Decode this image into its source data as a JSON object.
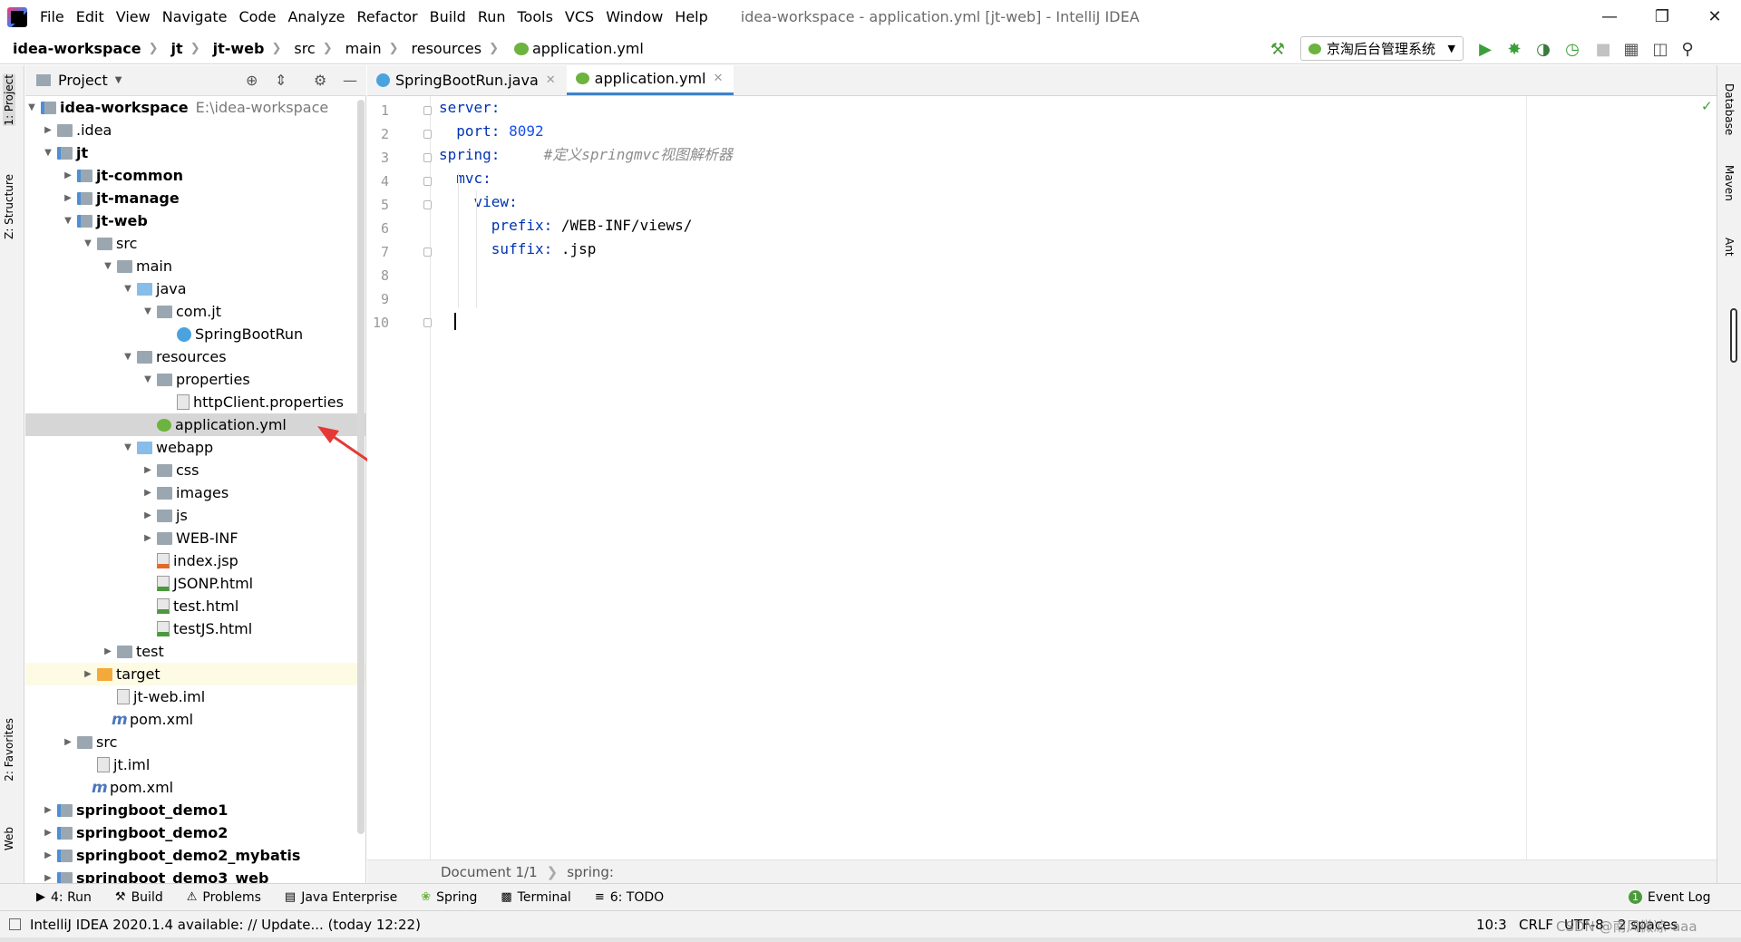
{
  "menubar": {
    "items": [
      "File",
      "Edit",
      "View",
      "Navigate",
      "Code",
      "Analyze",
      "Refactor",
      "Build",
      "Run",
      "Tools",
      "VCS",
      "Window",
      "Help"
    ],
    "window_title": "idea-workspace - application.yml [jt-web] - IntelliJ IDEA"
  },
  "breadcrumb": [
    "idea-workspace",
    "jt",
    "jt-web",
    "src",
    "main",
    "resources",
    "application.yml"
  ],
  "run_config": "京淘后台管理系统",
  "project_panel": {
    "title": "Project"
  },
  "left_strip": {
    "project": "1: Project",
    "structure": "Z: Structure",
    "favorites": "2: Favorites",
    "web": "Web"
  },
  "right_strip": {
    "database": "Database",
    "maven": "Maven",
    "ant": "Ant"
  },
  "tree": [
    {
      "label": "idea-workspace",
      "extra": "E:\\idea-workspace"
    },
    {
      "label": ".idea"
    },
    {
      "label": "jt"
    },
    {
      "label": "jt-common"
    },
    {
      "label": "jt-manage"
    },
    {
      "label": "jt-web"
    },
    {
      "label": "src"
    },
    {
      "label": "main"
    },
    {
      "label": "java"
    },
    {
      "label": "com.jt"
    },
    {
      "label": "SpringBootRun"
    },
    {
      "label": "resources"
    },
    {
      "label": "properties"
    },
    {
      "label": "httpClient.properties"
    },
    {
      "label": "application.yml"
    },
    {
      "label": "webapp"
    },
    {
      "label": "css"
    },
    {
      "label": "images"
    },
    {
      "label": "js"
    },
    {
      "label": "WEB-INF"
    },
    {
      "label": "index.jsp"
    },
    {
      "label": "JSONP.html"
    },
    {
      "label": "test.html"
    },
    {
      "label": "testJS.html"
    },
    {
      "label": "test"
    },
    {
      "label": "target"
    },
    {
      "label": "jt-web.iml"
    },
    {
      "label": "pom.xml"
    },
    {
      "label": "src"
    },
    {
      "label": "jt.iml"
    },
    {
      "label": "pom.xml"
    },
    {
      "label": "springboot_demo1"
    },
    {
      "label": "springboot_demo2"
    },
    {
      "label": "springboot_demo2_mybatis"
    },
    {
      "label": "springboot_demo3_web"
    }
  ],
  "tabs": [
    {
      "label": "SpringBootRun.java"
    },
    {
      "label": "application.yml"
    }
  ],
  "code": {
    "line_numbers": [
      "1",
      "2",
      "3",
      "4",
      "5",
      "6",
      "7",
      "8",
      "9",
      "10"
    ],
    "l1_key": "server:",
    "l2_key": "  port:",
    "l2_val": " 8092",
    "l3_key": "spring:",
    "l3_comment": "     #定义springmvc视图解析器",
    "l4_key": "  mvc:",
    "l5_key": "    view:",
    "l6_key": "      prefix:",
    "l6_val": " /WEB-INF/views/",
    "l7_key": "      suffix:",
    "l7_val": " .jsp"
  },
  "editor_status": {
    "doc": "Document 1/1",
    "path": "spring:"
  },
  "toolwindows": [
    "4: Run",
    "Build",
    "Problems",
    "Java Enterprise",
    "Spring",
    "Terminal",
    "6: TODO"
  ],
  "event_log": "Event Log",
  "event_count": "1",
  "statusbar": {
    "message": "IntelliJ IDEA 2020.1.4 available: // Update... (today 12:22)",
    "position": "10:3",
    "line_sep": "CRLF",
    "encoding": "UTF-8",
    "indent": "2 spaces",
    "watermark": "CSDN @南风微凉-aaa"
  }
}
